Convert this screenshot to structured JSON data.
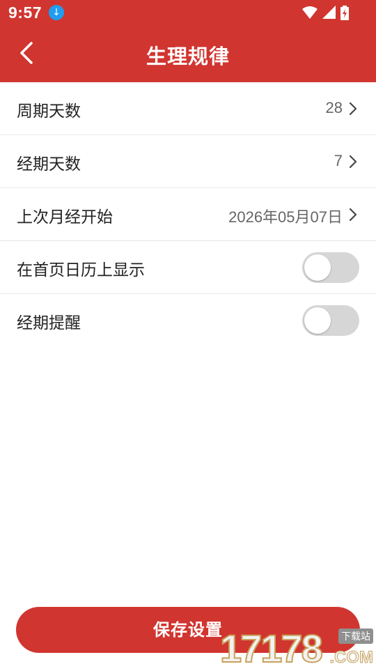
{
  "status_bar": {
    "time": "9:57",
    "download_badge": "↓",
    "icons": [
      "wifi-icon",
      "signal-icon",
      "battery-charging-icon"
    ]
  },
  "header": {
    "title": "生理规律",
    "back_icon": "chevron-left-icon"
  },
  "settings": [
    {
      "label": "周期天数",
      "value": "28"
    },
    {
      "label": "经期天数",
      "value": "7"
    },
    {
      "label": "上次月经开始",
      "value": "2026年05月07日"
    },
    {
      "label": "在首页日历上显示",
      "toggle": false
    },
    {
      "label": "经期提醒",
      "toggle": false
    }
  ],
  "save_button": {
    "label": "保存设置"
  },
  "watermark": {
    "digits": "17178",
    "domain": ".COM",
    "tag": "下载站"
  },
  "colors": {
    "primary": "#d13530",
    "toggle_off": "#d6d6d6",
    "badge": "#1f9df0"
  }
}
